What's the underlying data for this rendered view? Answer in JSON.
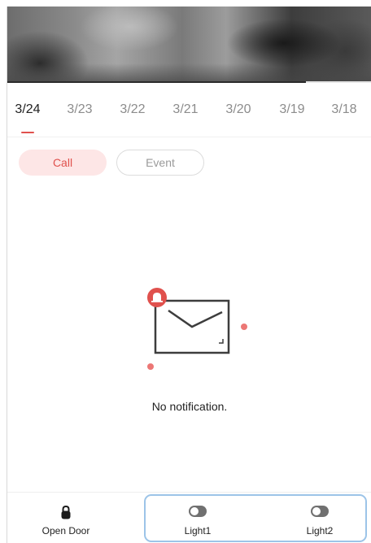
{
  "video": {
    "progress_fraction": 0.82
  },
  "dates": {
    "items": [
      "3/24",
      "3/23",
      "3/22",
      "3/21",
      "3/20",
      "3/19",
      "3/18"
    ],
    "selected_index": 0
  },
  "filters": {
    "call_label": "Call",
    "event_label": "Event",
    "selected": "Call"
  },
  "empty_state": {
    "message": "No notification."
  },
  "bottom_bar": {
    "open_door_label": "Open Door",
    "light1_label": "Light1",
    "light2_label": "Light2",
    "light1_on": false,
    "light2_on": false
  },
  "colors": {
    "accent": "#e0514d",
    "accent_soft": "#fde6e6",
    "highlight_border": "#9cc4e8",
    "toggle_off": "#707070"
  }
}
